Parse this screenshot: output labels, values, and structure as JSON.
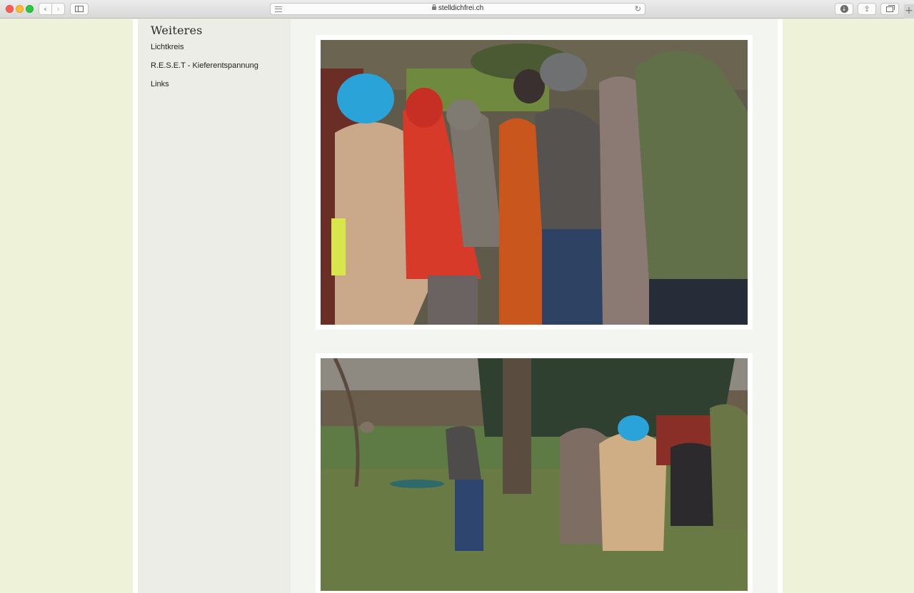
{
  "browser": {
    "url": "stelldichfrei.ch"
  },
  "sidebar": {
    "title": "Weiteres",
    "links": [
      {
        "label": "Lichtkreis"
      },
      {
        "label": "R.E.S.E.T - Kieferentspannung"
      },
      {
        "label": "Links"
      }
    ]
  },
  "colors": {
    "page_bg": "#eef2d8",
    "sidebar_bg": "#ecede7",
    "content_bg": "#f3f5f1"
  }
}
